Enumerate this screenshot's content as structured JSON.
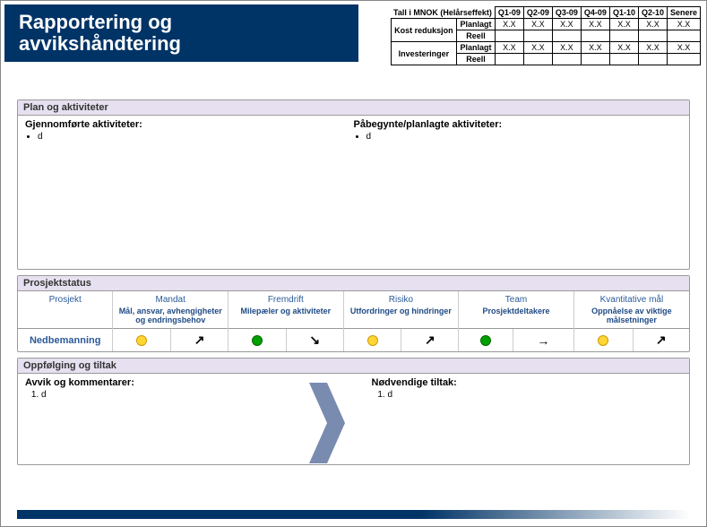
{
  "header": {
    "title_line1": "Rapportering og",
    "title_line2": "avvikshåndtering"
  },
  "top_table": {
    "caption": "Tall i MNOK (Helårseffekt)",
    "quarters": [
      "Q1-09",
      "Q2-09",
      "Q3-09",
      "Q4-09",
      "Q1-10",
      "Q2-10",
      "Senere"
    ],
    "rows": [
      {
        "group": "Kost reduksjon",
        "sub": "Planlagt",
        "vals": [
          "X.X",
          "X.X",
          "X.X",
          "X.X",
          "X.X",
          "X.X",
          "X.X"
        ]
      },
      {
        "group": "",
        "sub": "Reell",
        "vals": [
          "",
          "",
          "",
          "",
          "",
          "",
          ""
        ]
      },
      {
        "group": "Investeringer",
        "sub": "Planlagt",
        "vals": [
          "X.X",
          "X.X",
          "X.X",
          "X.X",
          "X.X",
          "X.X",
          "X.X"
        ]
      },
      {
        "group": "",
        "sub": "Reell",
        "vals": [
          "",
          "",
          "",
          "",
          "",
          "",
          ""
        ]
      }
    ]
  },
  "plan": {
    "section_title": "Plan og aktiviteter",
    "left_heading": "Gjennomførte aktiviteter:",
    "left_items": [
      "d"
    ],
    "right_heading": "Påbegynte/planlagte aktiviteter:",
    "right_items": [
      "d"
    ]
  },
  "status": {
    "section_title": "Prosjektstatus",
    "columns": [
      {
        "h": "Prosjekt",
        "sub": ""
      },
      {
        "h": "Mandat",
        "sub": "Mål, ansvar, avhengigheter og endringsbehov"
      },
      {
        "h": "Fremdrift",
        "sub": "Milepæler og aktiviteter"
      },
      {
        "h": "Risiko",
        "sub": "Utfordringer og hindringer"
      },
      {
        "h": "Team",
        "sub": "Prosjektdeltakere"
      },
      {
        "h": "Kvantitative mål",
        "sub": "Oppnåelse av viktige målsetninger"
      }
    ],
    "project_row": {
      "name": "Nedbemanning",
      "cells": [
        {
          "dot": "yellow",
          "arrow": "↗"
        },
        {
          "dot": "green",
          "arrow": "↘"
        },
        {
          "dot": "yellow",
          "arrow": "↗"
        },
        {
          "dot": "green",
          "arrow": "→"
        },
        {
          "dot": "yellow",
          "arrow": "↗"
        }
      ]
    }
  },
  "followup": {
    "section_title": "Oppfølging og tiltak",
    "left_heading": "Avvik og kommentarer:",
    "left_items": [
      "d"
    ],
    "right_heading": "Nødvendige tiltak:",
    "right_items": [
      "d"
    ]
  }
}
